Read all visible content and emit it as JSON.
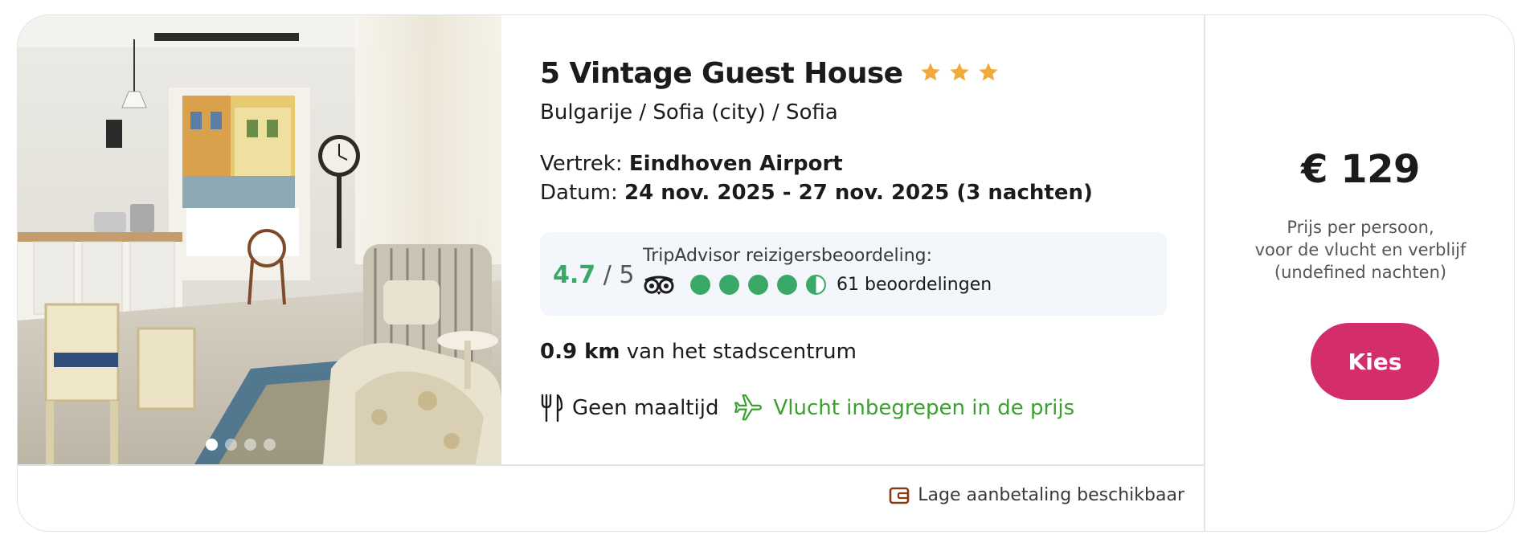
{
  "hotel": {
    "name": "5 Vintage Guest House",
    "stars": 3,
    "location": "Bulgarije / Sofia (city) / Sofia"
  },
  "departure": {
    "label": "Vertrek:",
    "value": "Eindhoven Airport"
  },
  "date": {
    "label": "Datum:",
    "value": "24 nov. 2025 - 27 nov. 2025 (3 nachten)"
  },
  "rating": {
    "score": "4.7",
    "max": "/ 5",
    "label": "TripAdvisor reizigersbeoordeling:",
    "bubbles": 4.5,
    "reviews": "61 beoordelingen"
  },
  "distance": {
    "value": "0.9 km",
    "text": "van het stadscentrum"
  },
  "features": {
    "meal": "Geen maaltijd",
    "flight": "Vlucht inbegrepen in de prijs"
  },
  "deposit": "Lage aanbetaling beschikbaar",
  "price": {
    "amount": "€ 129",
    "note_line1": "Prijs per persoon,",
    "note_line2": "voor de vlucht en verblijf",
    "note_line3": "(undefined nachten)"
  },
  "button": {
    "label": "Kies"
  },
  "gallery": {
    "slides": 4,
    "active": 0
  },
  "colors": {
    "accent": "#d42d6b",
    "star": "#f0a93a",
    "rating_green": "#3aa866",
    "flight_green": "#3aa12e",
    "deposit_icon": "#8a3b12"
  }
}
